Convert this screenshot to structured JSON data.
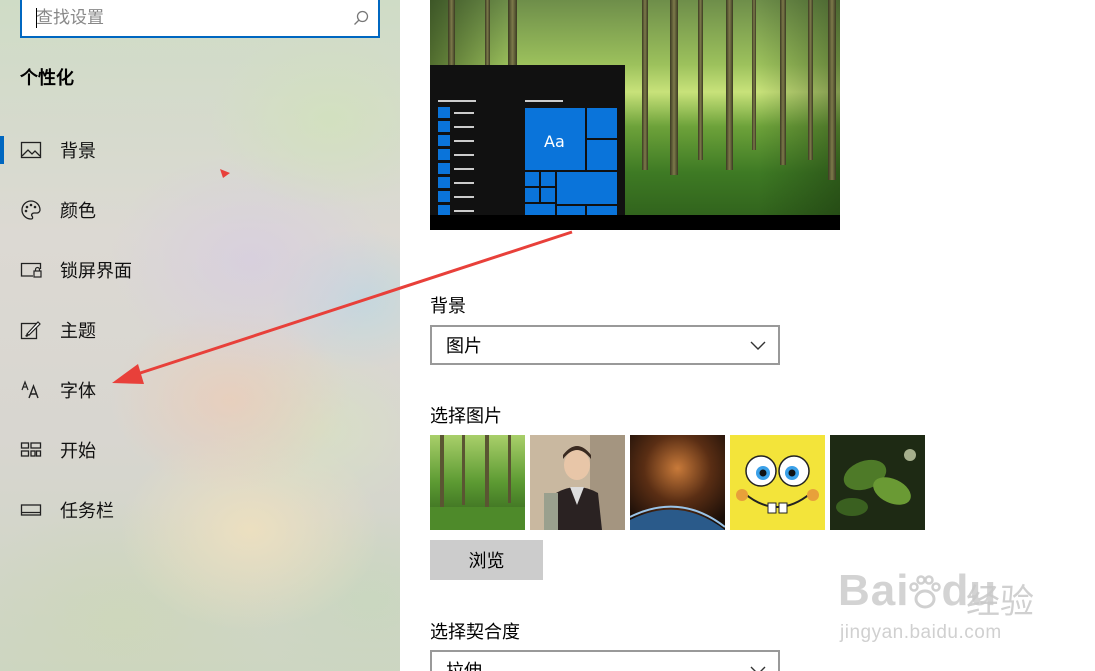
{
  "search": {
    "placeholder": "查找设置"
  },
  "sidebar": {
    "title": "个性化",
    "items": [
      {
        "label": "背景",
        "icon": "picture-icon",
        "active": true
      },
      {
        "label": "颜色",
        "icon": "palette-icon",
        "active": false
      },
      {
        "label": "锁屏界面",
        "icon": "lock-screen-icon",
        "active": false
      },
      {
        "label": "主题",
        "icon": "theme-brush-icon",
        "active": false
      },
      {
        "label": "字体",
        "icon": "font-icon",
        "active": false
      },
      {
        "label": "开始",
        "icon": "start-tiles-icon",
        "active": false
      },
      {
        "label": "任务栏",
        "icon": "taskbar-icon",
        "active": false
      }
    ]
  },
  "preview": {
    "tile_label": "Aa"
  },
  "background": {
    "label": "背景",
    "selected": "图片"
  },
  "choose_picture": {
    "label": "选择图片",
    "thumbnails": [
      "forest",
      "portrait",
      "space-planet",
      "spongebob",
      "green-leaves"
    ],
    "browse_label": "浏览"
  },
  "fit": {
    "label": "选择契合度",
    "selected": "拉伸"
  },
  "watermark": {
    "brand": "Bai",
    "brand2": "du",
    "cn": "经验",
    "url": "jingyan.baidu.com"
  },
  "colors": {
    "accent": "#0067c0",
    "tile_blue": "#0a74da",
    "annotation_red": "#e8403a"
  }
}
